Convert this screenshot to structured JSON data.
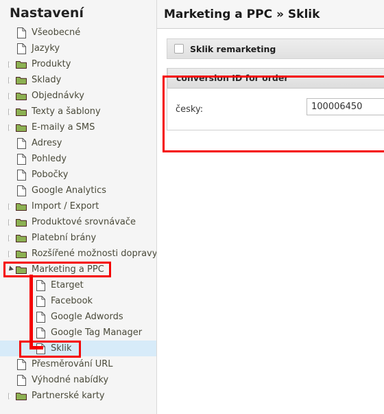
{
  "sidebar": {
    "title": "Nastavení",
    "items": [
      {
        "label": "Všeobecné",
        "icon": "page-icon",
        "depth": 1,
        "expandable": false,
        "expanded": false,
        "selected": false
      },
      {
        "label": "Jazyky",
        "icon": "page-icon",
        "depth": 1,
        "expandable": false,
        "expanded": false,
        "selected": false
      },
      {
        "label": "Produkty",
        "icon": "folder-icon",
        "depth": 1,
        "expandable": true,
        "expanded": false,
        "selected": false
      },
      {
        "label": "Sklady",
        "icon": "folder-icon",
        "depth": 1,
        "expandable": true,
        "expanded": false,
        "selected": false
      },
      {
        "label": "Objednávky",
        "icon": "folder-icon",
        "depth": 1,
        "expandable": true,
        "expanded": false,
        "selected": false
      },
      {
        "label": "Texty a šablony",
        "icon": "folder-icon",
        "depth": 1,
        "expandable": true,
        "expanded": false,
        "selected": false
      },
      {
        "label": "E-maily a SMS",
        "icon": "folder-icon",
        "depth": 1,
        "expandable": true,
        "expanded": false,
        "selected": false
      },
      {
        "label": "Adresy",
        "icon": "page-icon",
        "depth": 1,
        "expandable": false,
        "expanded": false,
        "selected": false
      },
      {
        "label": "Pohledy",
        "icon": "page-icon",
        "depth": 1,
        "expandable": false,
        "expanded": false,
        "selected": false
      },
      {
        "label": "Pobočky",
        "icon": "page-icon",
        "depth": 1,
        "expandable": false,
        "expanded": false,
        "selected": false
      },
      {
        "label": "Google Analytics",
        "icon": "page-icon",
        "depth": 1,
        "expandable": false,
        "expanded": false,
        "selected": false
      },
      {
        "label": "Import / Export",
        "icon": "folder-icon",
        "depth": 1,
        "expandable": true,
        "expanded": false,
        "selected": false
      },
      {
        "label": "Produktové srovnávače",
        "icon": "folder-icon",
        "depth": 1,
        "expandable": true,
        "expanded": false,
        "selected": false
      },
      {
        "label": "Platební brány",
        "icon": "folder-icon",
        "depth": 1,
        "expandable": true,
        "expanded": false,
        "selected": false
      },
      {
        "label": "Rozšířené možnosti dopravy",
        "icon": "folder-icon",
        "depth": 1,
        "expandable": true,
        "expanded": false,
        "selected": false
      },
      {
        "label": "Marketing a PPC",
        "icon": "folder-icon",
        "depth": 1,
        "expandable": true,
        "expanded": true,
        "selected": false
      },
      {
        "label": "Etarget",
        "icon": "page-icon",
        "depth": 2,
        "expandable": false,
        "expanded": false,
        "selected": false
      },
      {
        "label": "Facebook",
        "icon": "page-icon",
        "depth": 2,
        "expandable": false,
        "expanded": false,
        "selected": false
      },
      {
        "label": "Google Adwords",
        "icon": "page-icon",
        "depth": 2,
        "expandable": false,
        "expanded": false,
        "selected": false
      },
      {
        "label": "Google Tag Manager",
        "icon": "page-icon",
        "depth": 2,
        "expandable": false,
        "expanded": false,
        "selected": false
      },
      {
        "label": "Sklik",
        "icon": "page-icon",
        "depth": 2,
        "expandable": false,
        "expanded": false,
        "selected": true
      },
      {
        "label": "Přesměrování URL",
        "icon": "page-icon",
        "depth": 1,
        "expandable": false,
        "expanded": false,
        "selected": false
      },
      {
        "label": "Výhodné nabídky",
        "icon": "page-icon",
        "depth": 1,
        "expandable": false,
        "expanded": false,
        "selected": false
      },
      {
        "label": "Partnerské karty",
        "icon": "folder-icon",
        "depth": 1,
        "expandable": true,
        "expanded": false,
        "selected": false
      }
    ]
  },
  "header": {
    "title": "Marketing a PPC » Sklik"
  },
  "main": {
    "remarketing": {
      "label": "Sklik remarketing",
      "checked": false
    },
    "conversion_panel": {
      "title": "conversion ID for order",
      "field_label": "česky:",
      "field_value": "100006450",
      "field_placeholder": ""
    }
  },
  "annotations": {
    "color": "#f50000",
    "boxes": [
      {
        "name": "conversion-panel-highlight"
      },
      {
        "name": "marketing-ppc-highlight"
      },
      {
        "name": "sklik-highlight"
      }
    ]
  },
  "colors": {
    "folder_green": "#8cb152",
    "selection_blue": "#d7ebf9",
    "annotation_red": "#f50000",
    "sidebar_bg": "#f5f5f5"
  }
}
